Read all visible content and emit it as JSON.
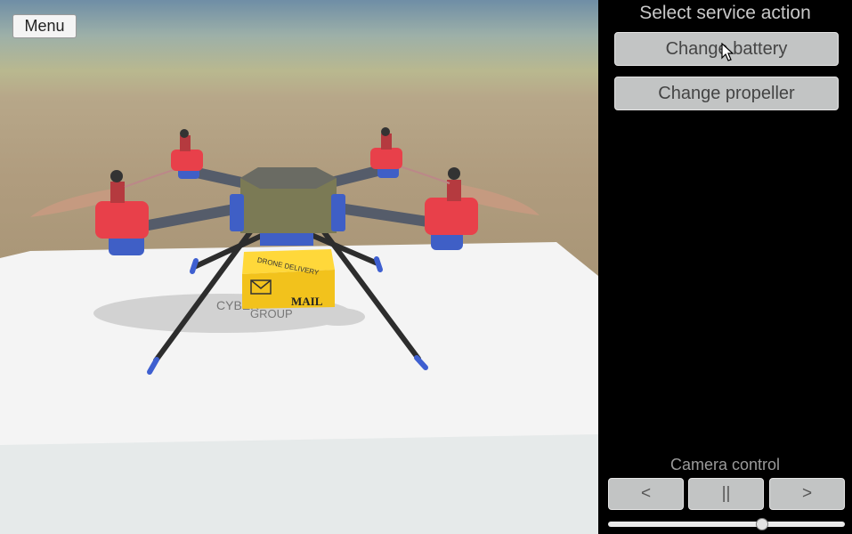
{
  "viewport": {
    "menu_label": "Menu",
    "scene_label_line1": "CYBER",
    "scene_label_line2": "GROUP",
    "package_text": "MAIL",
    "package_tape_text": "DRONE DELIVERY"
  },
  "panel": {
    "title": "Select service action",
    "actions": [
      {
        "label": "Change battery"
      },
      {
        "label": "Change propeller"
      }
    ],
    "camera": {
      "label": "Camera control",
      "prev_label": "<",
      "pause_label": "||",
      "next_label": ">",
      "slider_value": 0.65
    }
  },
  "colors": {
    "motor_red": "#e8404a",
    "motor_blue": "#3f5fc6",
    "package_yellow": "#f2c21c",
    "panel_button": "#c2c4c4"
  }
}
